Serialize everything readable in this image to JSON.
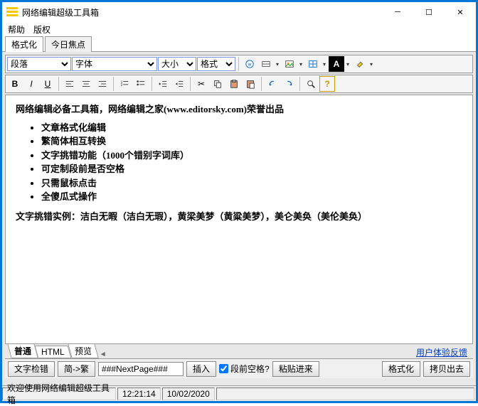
{
  "window": {
    "title": "网络编辑超级工具箱"
  },
  "menu": {
    "help": "帮助",
    "copyright": "版权"
  },
  "mainTabs": {
    "format": "格式化",
    "today": "今日焦点"
  },
  "toolbar": {
    "paragraph": "段落",
    "font": "字体",
    "size": "大小",
    "style": "格式"
  },
  "content": {
    "heading": "网络编辑必备工具箱，网络编辑之家(www.editorsky.com)荣誉出品",
    "items": [
      "文章格式化编辑",
      "繁简体相互转换",
      "文字挑错功能（1000个错别字词库）",
      "可定制段前是否空格",
      "只需鼠标点击",
      "全傻瓜式操作"
    ],
    "example": "文字挑错实例：洁白无暇（洁白无瑕），黄梁美梦（黄粱美梦），美仑美奂（美伦美奂）"
  },
  "subTabs": {
    "normal": "普通",
    "html": "HTML",
    "preview": "预览"
  },
  "actions": {
    "proofread": "文字检错",
    "s2t": "简->繁",
    "nextpage": "###NextPage###",
    "insert": "插入",
    "prespace": "段前空格?",
    "pastein": "粘贴进来",
    "formatize": "格式化",
    "copyout": "拷贝出去",
    "feedback": "用户体验反馈"
  },
  "status": {
    "welcome": "欢迎使用网络编辑超级工具箱",
    "time": "12:21:14",
    "date": "10/02/2020"
  }
}
